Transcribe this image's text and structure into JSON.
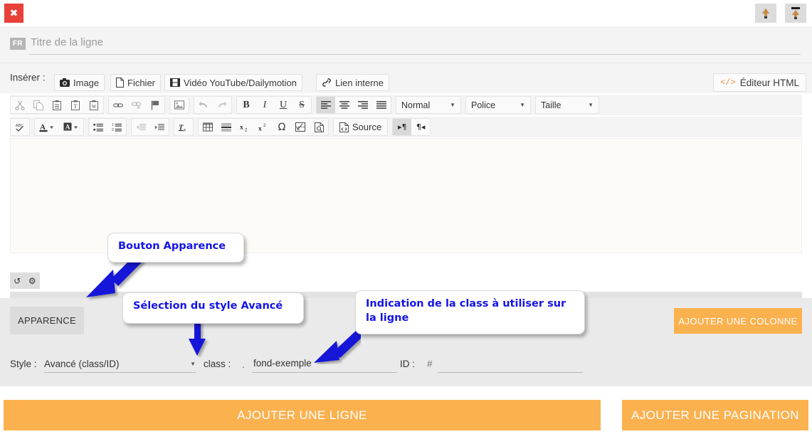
{
  "topbar": {
    "close_label": "✖",
    "btn_up": "arrow-up-icon",
    "btn_up_to_top": "arrow-up-to-line-icon"
  },
  "title": {
    "lang_badge": "FR",
    "placeholder": "Titre de la ligne",
    "value": ""
  },
  "insert": {
    "label": "Insérer :",
    "buttons": [
      {
        "icon": "camera-icon",
        "label": "Image"
      },
      {
        "icon": "file-icon",
        "label": "Fichier"
      },
      {
        "icon": "film-icon",
        "label": "Vidéo YouTube/Dailymotion"
      },
      {
        "icon": "link-icon",
        "label": "Lien interne"
      }
    ],
    "html_editor": {
      "icon": "code-icon",
      "label": "Éditeur HTML"
    }
  },
  "toolbar_row1": {
    "group1": [
      "cut-icon",
      "copy-icon",
      "paste-icon",
      "paste-text-icon",
      "paste-word-icon"
    ],
    "group2": [
      "link-icon",
      "unlink-icon",
      "anchor-flag-icon"
    ],
    "group3": [
      "image-icon"
    ],
    "group4": [
      "undo-icon",
      "redo-icon"
    ],
    "group5": [
      "bold-icon",
      "italic-icon",
      "underline-icon",
      "strikethrough-icon"
    ],
    "group6": [
      "align-left-icon",
      "align-center-icon",
      "align-right-icon",
      "align-justify-icon"
    ],
    "active": "align-left-icon",
    "selects": [
      {
        "name": "paragraph-format",
        "value": "Normal"
      },
      {
        "name": "font-family",
        "value": "Police"
      },
      {
        "name": "font-size",
        "value": "Taille"
      }
    ]
  },
  "toolbar_row2": {
    "group1": [
      "spellcheck-icon"
    ],
    "group2": [
      "text-color-icon",
      "background-color-icon"
    ],
    "group3": [
      "bulleted-list-icon",
      "numbered-list-icon"
    ],
    "group4": [
      "outdent-icon",
      "indent-icon"
    ],
    "group5": [
      "remove-format-icon"
    ],
    "group6": [
      "table-icon",
      "horizontal-rule-icon",
      "subscript-icon",
      "superscript-icon",
      "special-char-icon",
      "page-break-icon",
      "preview-icon"
    ],
    "source_button": {
      "icon": "source-icon",
      "label": "Source"
    },
    "direction": [
      {
        "name": "ltr-icon",
        "glyph": "▸¶",
        "active": true
      },
      {
        "name": "rtl-icon",
        "glyph": "¶◂",
        "active": false
      }
    ]
  },
  "mini_tools": {
    "reset": "↺",
    "settings": "⚙"
  },
  "appearance": {
    "apparence_button": "APPARENCE",
    "add_column_button": "AJOUTER UNE COLONNE",
    "style_label": "Style :",
    "style_value": "Avancé (class/ID)",
    "class_label": "class :",
    "class_prefix": ".",
    "class_value": "fond-exemple",
    "id_label": "ID :",
    "id_prefix": "#",
    "id_value": ""
  },
  "footer": {
    "add_row_button": "AJOUTER UNE LIGNE",
    "add_pagination_button": "AJOUTER UNE PAGINATION"
  },
  "callouts": [
    {
      "name": "callout-bouton-apparence",
      "text": "Bouton Apparence"
    },
    {
      "name": "callout-selection-style",
      "text": "Sélection du style Avancé"
    },
    {
      "name": "callout-indication-class",
      "text": "Indication de la class à utiliser sur la ligne"
    }
  ],
  "colors": {
    "accent_orange": "#fcb14f",
    "close_red": "#e8413a",
    "callout_blue": "#1414e6",
    "arrow_blue": "#1414d8"
  }
}
